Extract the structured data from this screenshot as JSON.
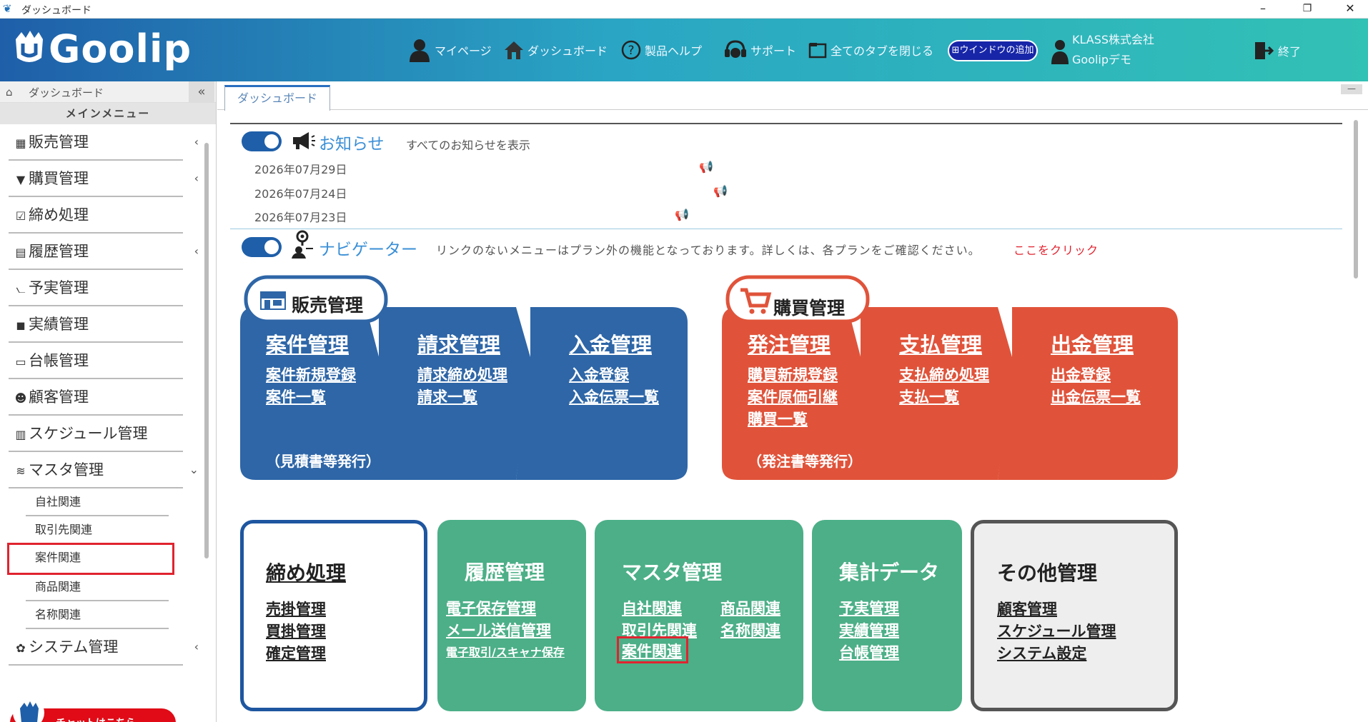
{
  "window": {
    "title": "ダッシュボード",
    "minimize": "–",
    "restore": "❐",
    "close": "✕"
  },
  "header": {
    "logo": "Goolip",
    "nav": [
      {
        "label": "マイページ",
        "icon": "person-icon"
      },
      {
        "label": "ダッシュボード",
        "icon": "home-icon"
      },
      {
        "label": "製品ヘルプ",
        "icon": "help-icon"
      },
      {
        "label": "サポート",
        "icon": "headset-icon"
      },
      {
        "label": "全てのタブを閉じる",
        "icon": "tabs-icon"
      }
    ],
    "add_window": "ウインドウの追加",
    "user_company": "KLASS株式会社",
    "user_name": "Goolipデモ",
    "exit": "終了"
  },
  "sidebar": {
    "top_label": "ダッシュボード",
    "collapse": "«",
    "menu_header": "メインメニュー",
    "items": [
      {
        "label": "販売管理",
        "icon": "store-icon",
        "chevron": "‹"
      },
      {
        "label": "購買管理",
        "icon": "cart-icon",
        "chevron": "‹"
      },
      {
        "label": "締め処理",
        "icon": "checkbox-icon",
        "chevron": ""
      },
      {
        "label": "履歴管理",
        "icon": "document-icon",
        "chevron": "‹"
      },
      {
        "label": "予実管理",
        "icon": "chart-icon",
        "chevron": ""
      },
      {
        "label": "実績管理",
        "icon": "bookmark-icon",
        "chevron": ""
      },
      {
        "label": "台帳管理",
        "icon": "book-icon",
        "chevron": ""
      },
      {
        "label": "顧客管理",
        "icon": "users-icon",
        "chevron": ""
      },
      {
        "label": "スケジュール管理",
        "icon": "calendar-icon",
        "chevron": ""
      },
      {
        "label": "マスタ管理",
        "icon": "database-icon",
        "chevron": "⌄"
      }
    ],
    "subitems": [
      "自社関連",
      "取引先関連",
      "案件関連",
      "商品関連",
      "名称関連"
    ],
    "system": {
      "label": "システム管理",
      "icon": "gear-icon",
      "chevron": "‹"
    },
    "chat": "チャットはこちら"
  },
  "tabs": [
    {
      "label": "ダッシュボード"
    }
  ],
  "tab_minimize": "—",
  "news": {
    "title": "お知らせ",
    "show_all": "すべてのお知らせを表示",
    "items": [
      {
        "date": "2026年07月29日"
      },
      {
        "date": "2026年07月24日"
      },
      {
        "date": "2026年07月23日"
      }
    ]
  },
  "navigator": {
    "title": "ナビゲーター",
    "note": "リンクのないメニューはプラン外の機能となっております。詳しくは、各プランをご確認ください。",
    "link": "ここをクリック"
  },
  "sales": {
    "badge": "販売管理",
    "cols": [
      {
        "title": "案件管理",
        "links": [
          "案件新規登録",
          "案件一覧"
        ],
        "note": "（見積書等発行）"
      },
      {
        "title": "請求管理",
        "links": [
          "請求締め処理",
          "請求一覧"
        ],
        "note": ""
      },
      {
        "title": "入金管理",
        "links": [
          "入金登録",
          "入金伝票一覧"
        ],
        "note": ""
      }
    ]
  },
  "purchase": {
    "badge": "購買管理",
    "cols": [
      {
        "title": "発注管理",
        "links": [
          "購買新規登録",
          "案件原価引継",
          "購買一覧"
        ],
        "note": "（発注書等発行）"
      },
      {
        "title": "支払管理",
        "links": [
          "支払締め処理",
          "支払一覧"
        ],
        "note": ""
      },
      {
        "title": "出金管理",
        "links": [
          "出金登録",
          "出金伝票一覧"
        ],
        "note": ""
      }
    ]
  },
  "boxes": {
    "closing": {
      "title": "締め処理",
      "links": [
        "売掛管理",
        "買掛管理",
        "確定管理"
      ]
    },
    "history": {
      "title": "履歴管理",
      "links": [
        "電子保存管理",
        "メール送信管理",
        "電子取引/スキャナ保存"
      ]
    },
    "master": {
      "title": "マスタ管理",
      "left": [
        "自社関連",
        "取引先関連",
        "案件関連"
      ],
      "right": [
        "商品関連",
        "名称関連"
      ]
    },
    "summary": {
      "title": "集計データ",
      "links": [
        "予実管理",
        "実績管理",
        "台帳管理"
      ]
    },
    "other": {
      "title": "その他管理",
      "links": [
        "顧客管理",
        "スケジュール管理",
        "システム設定"
      ]
    }
  },
  "colors": {
    "blue": "#2e66a7",
    "red": "#e0533a",
    "green": "#4caf87",
    "header_start": "#1f5fa9",
    "header_end": "#32c1b5",
    "highlight": "#e0232f"
  }
}
